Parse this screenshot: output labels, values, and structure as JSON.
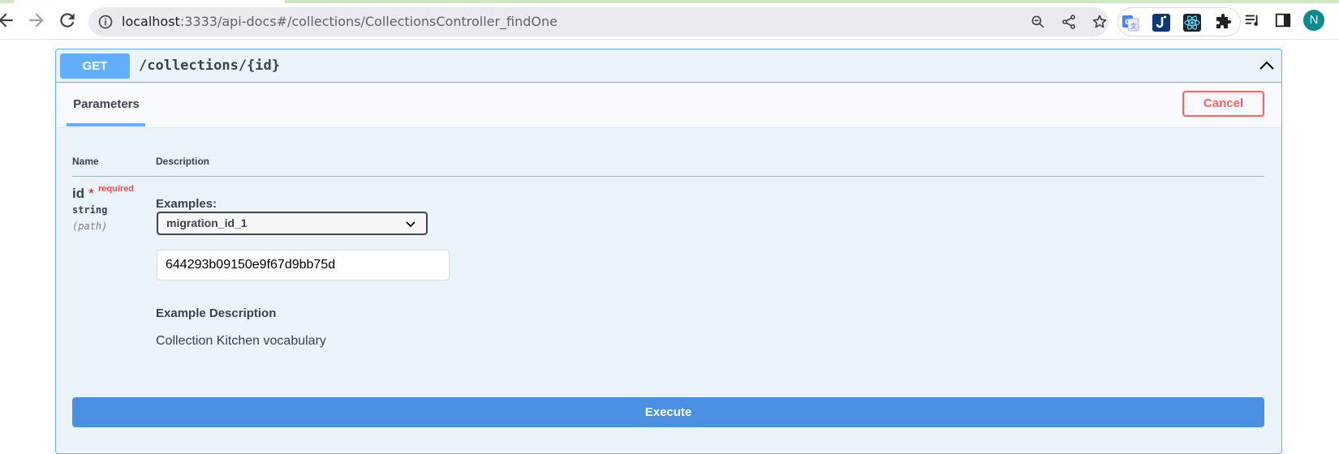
{
  "browser": {
    "url_host": "localhost",
    "url_rest": ":3333/api-docs#/collections/CollectionsController_findOne",
    "avatar_letter": "N",
    "icons": [
      "back-icon",
      "forward-icon",
      "reload-icon",
      "site-info-icon",
      "zoom-icon",
      "share-icon",
      "bookmark-star-icon",
      "google-translate-icon",
      "jira-extension-icon",
      "react-devtools-icon",
      "extensions-puzzle-icon",
      "media-queue-icon",
      "side-panel-icon"
    ]
  },
  "operation": {
    "method": "GET",
    "path": "/collections/{id}"
  },
  "params_section": {
    "tab_label": "Parameters",
    "cancel_label": "Cancel",
    "col_name": "Name",
    "col_description": "Description"
  },
  "param": {
    "name": "id",
    "required_star": "*",
    "required_label": "required",
    "type": "string",
    "in": "(path)",
    "examples_label": "Examples:",
    "selected_example": "migration_id_1",
    "value": "644293b09150e9f67d9bb75d",
    "example_description_title": "Example Description",
    "example_description": "Collection Kitchen vocabulary"
  },
  "execute_label": "Execute",
  "colors": {
    "get_accent": "#61affe",
    "cancel_red": "#ff6060",
    "execute_blue": "#4990e2",
    "opblock_bg": "#ebf3fb"
  }
}
